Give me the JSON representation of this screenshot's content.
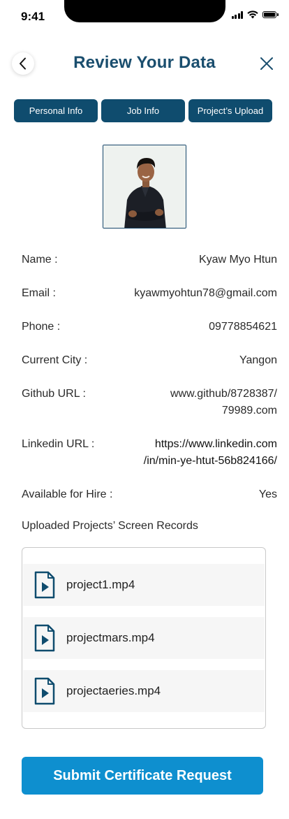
{
  "status_bar": {
    "time": "9:41",
    "icons": [
      "cellular-signal-icon",
      "wifi-icon",
      "battery-icon"
    ]
  },
  "header": {
    "title": "Review Your Data",
    "back_icon": "chevron-left-icon",
    "close_icon": "close-icon"
  },
  "tabs": [
    {
      "label": "Personal Info"
    },
    {
      "label": "Job Info"
    },
    {
      "label": "Project’s Upload"
    }
  ],
  "profile": {
    "photo_icon": "profile-photo"
  },
  "fields": [
    {
      "label": "Name :",
      "value": "Kyaw Myo Htun"
    },
    {
      "label": "Email :",
      "value": "kyawmyohtun78@gmail.com"
    },
    {
      "label": "Phone :",
      "value": "09778854621"
    },
    {
      "label": "Current City :",
      "value": "Yangon"
    },
    {
      "label": "Github URL :",
      "value_lines": [
        "www.github/8728387/",
        "79989.com"
      ]
    },
    {
      "label": "Linkedin URL :",
      "value_lines": [
        "https://www.linkedin.com",
        "/in/min-ye-htut-56b824166/"
      ]
    },
    {
      "label": "Available for Hire :",
      "value": "Yes"
    }
  ],
  "uploads": {
    "label": "Uploaded Projects’ Screen Records",
    "files": [
      {
        "name": "project1.mp4",
        "icon": "video-file-icon"
      },
      {
        "name": "projectmars.mp4",
        "icon": "video-file-icon"
      },
      {
        "name": "projectaeries.mp4",
        "icon": "video-file-icon"
      }
    ]
  },
  "submit": {
    "label": "Submit Certificate Request"
  },
  "colors": {
    "primary_dark": "#0f4c6e",
    "title": "#1a4e6e",
    "submit": "#0e8fcf"
  }
}
